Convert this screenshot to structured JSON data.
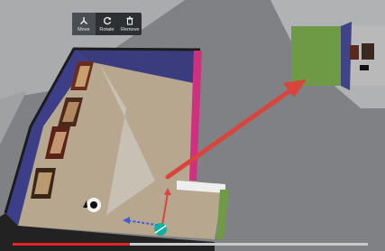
{
  "toolbar": {
    "move": {
      "label": "Move",
      "icon": "move-icon",
      "active": true
    },
    "rotate": {
      "label": "Rotate",
      "icon": "rotate-icon"
    },
    "remove": {
      "label": "Remove",
      "icon": "trash-icon"
    }
  },
  "video": {
    "progress": 0.33
  },
  "colors": {
    "floor": "#b7a68e",
    "wall": "#3e3f86",
    "accent_wall": "#cf2f80",
    "green_wall": "#6e9a46",
    "arrow": "#d9443d",
    "gizmo_teal": "#0fb0a4"
  }
}
